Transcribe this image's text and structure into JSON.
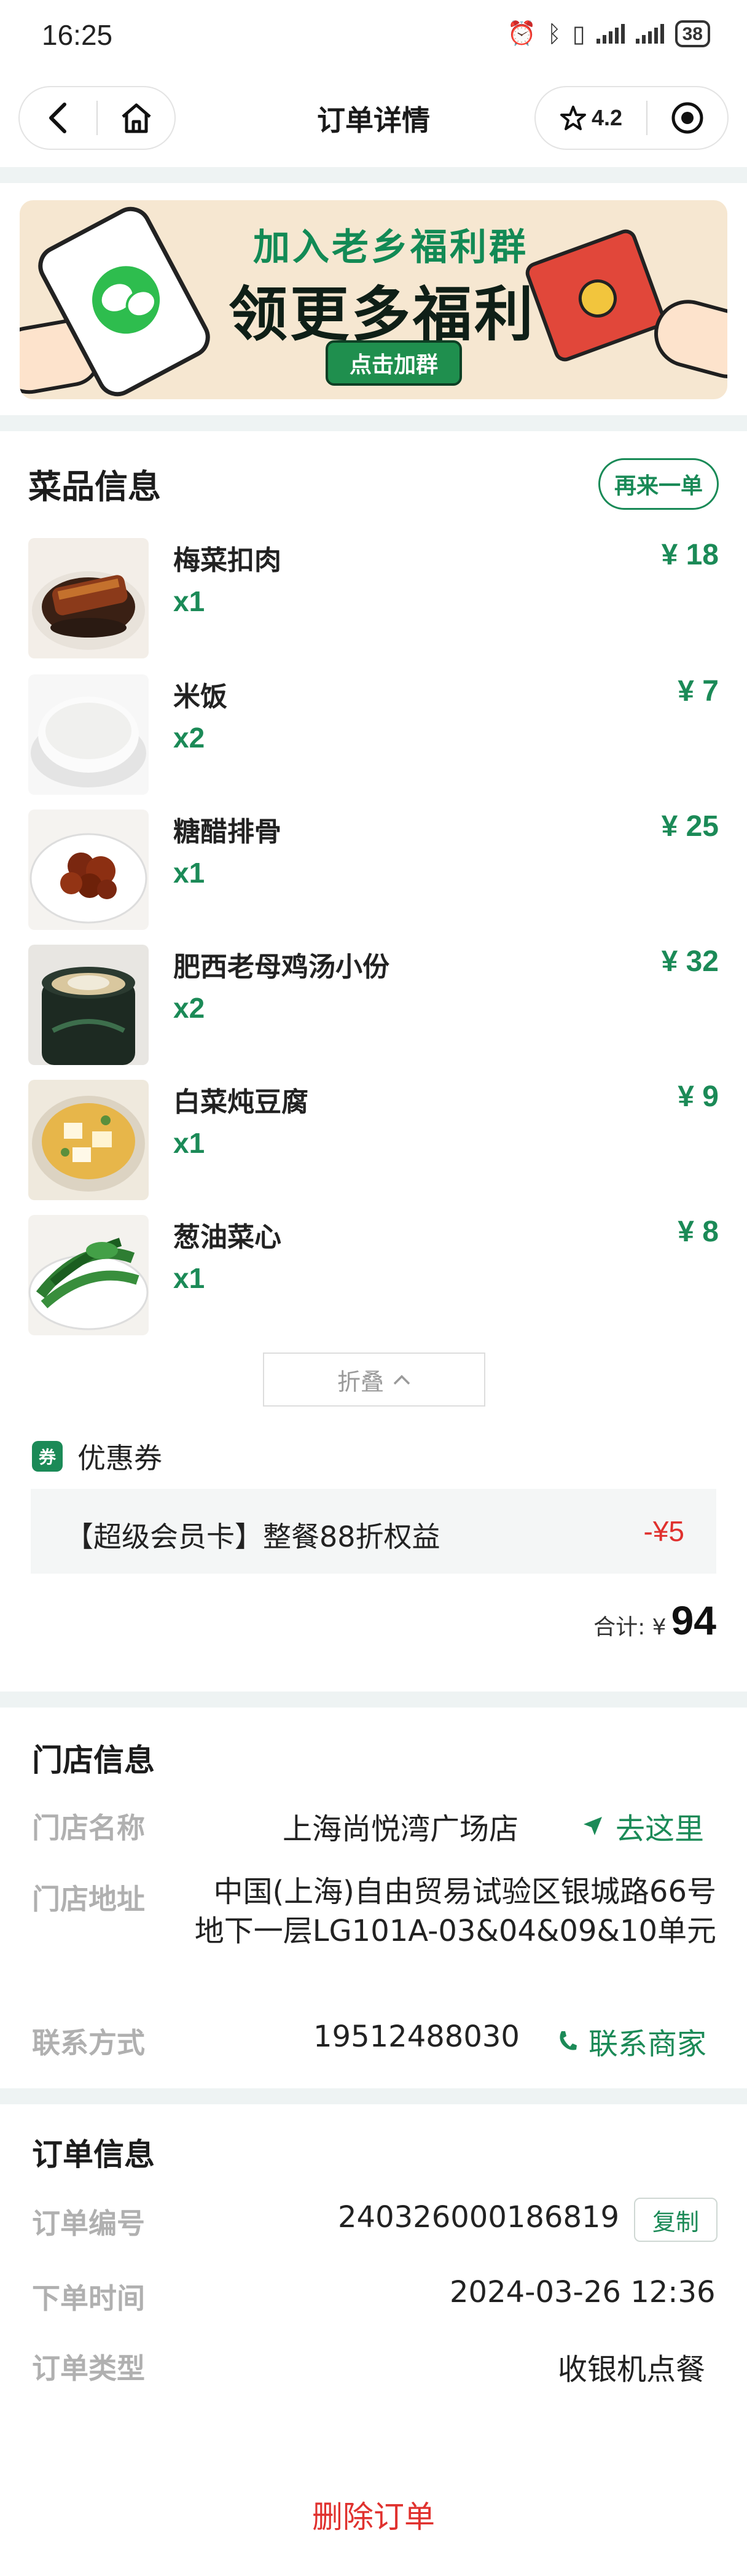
{
  "status_bar": {
    "time": "16:25",
    "battery": "38"
  },
  "nav": {
    "title": "订单详情",
    "rating": "4.2"
  },
  "banner": {
    "line1": "加入老乡福利群",
    "line2": "领更多福利",
    "button": "点击加群"
  },
  "dishes_section": {
    "title": "菜品信息",
    "reorder_label": "再来一单",
    "items": [
      {
        "name": "梅菜扣肉",
        "qty": "x1",
        "price": "¥ 18"
      },
      {
        "name": "米饭",
        "qty": "x2",
        "price": "¥ 7"
      },
      {
        "name": "糖醋排骨",
        "qty": "x1",
        "price": "¥ 25"
      },
      {
        "name": "肥西老母鸡汤小份",
        "qty": "x2",
        "price": "¥ 32"
      },
      {
        "name": "白菜炖豆腐",
        "qty": "x1",
        "price": "¥ 9"
      },
      {
        "name": "葱油菜心",
        "qty": "x1",
        "price": "¥ 8"
      }
    ],
    "fold_label": "折叠"
  },
  "coupon": {
    "tag": "券",
    "title": "优惠券",
    "name": "【超级会员卡】整餐88折权益",
    "amount": "-¥5"
  },
  "total": {
    "label": "合计: ¥",
    "value": "94"
  },
  "store": {
    "title": "门店信息",
    "name_label": "门店名称",
    "name": "上海尚悦湾广场店",
    "navigate_label": "去这里",
    "address_label": "门店地址",
    "address": "中国(上海)自由贸易试验区银城路66号地下一层LG101A-03&04&09&10单元",
    "contact_label": "联系方式",
    "phone": "19512488030",
    "contact_link": "联系商家"
  },
  "order": {
    "title": "订单信息",
    "number_label": "订单编号",
    "number": "240326000186819",
    "copy_label": "复制",
    "time_label": "下单时间",
    "time": "2024-03-26 12:36",
    "type_label": "订单类型",
    "type": "收银机点餐"
  },
  "delete_label": "删除订单",
  "colors": {
    "accent": "#1b8a57",
    "danger": "#e0312e",
    "divider": "#eef3f3"
  }
}
